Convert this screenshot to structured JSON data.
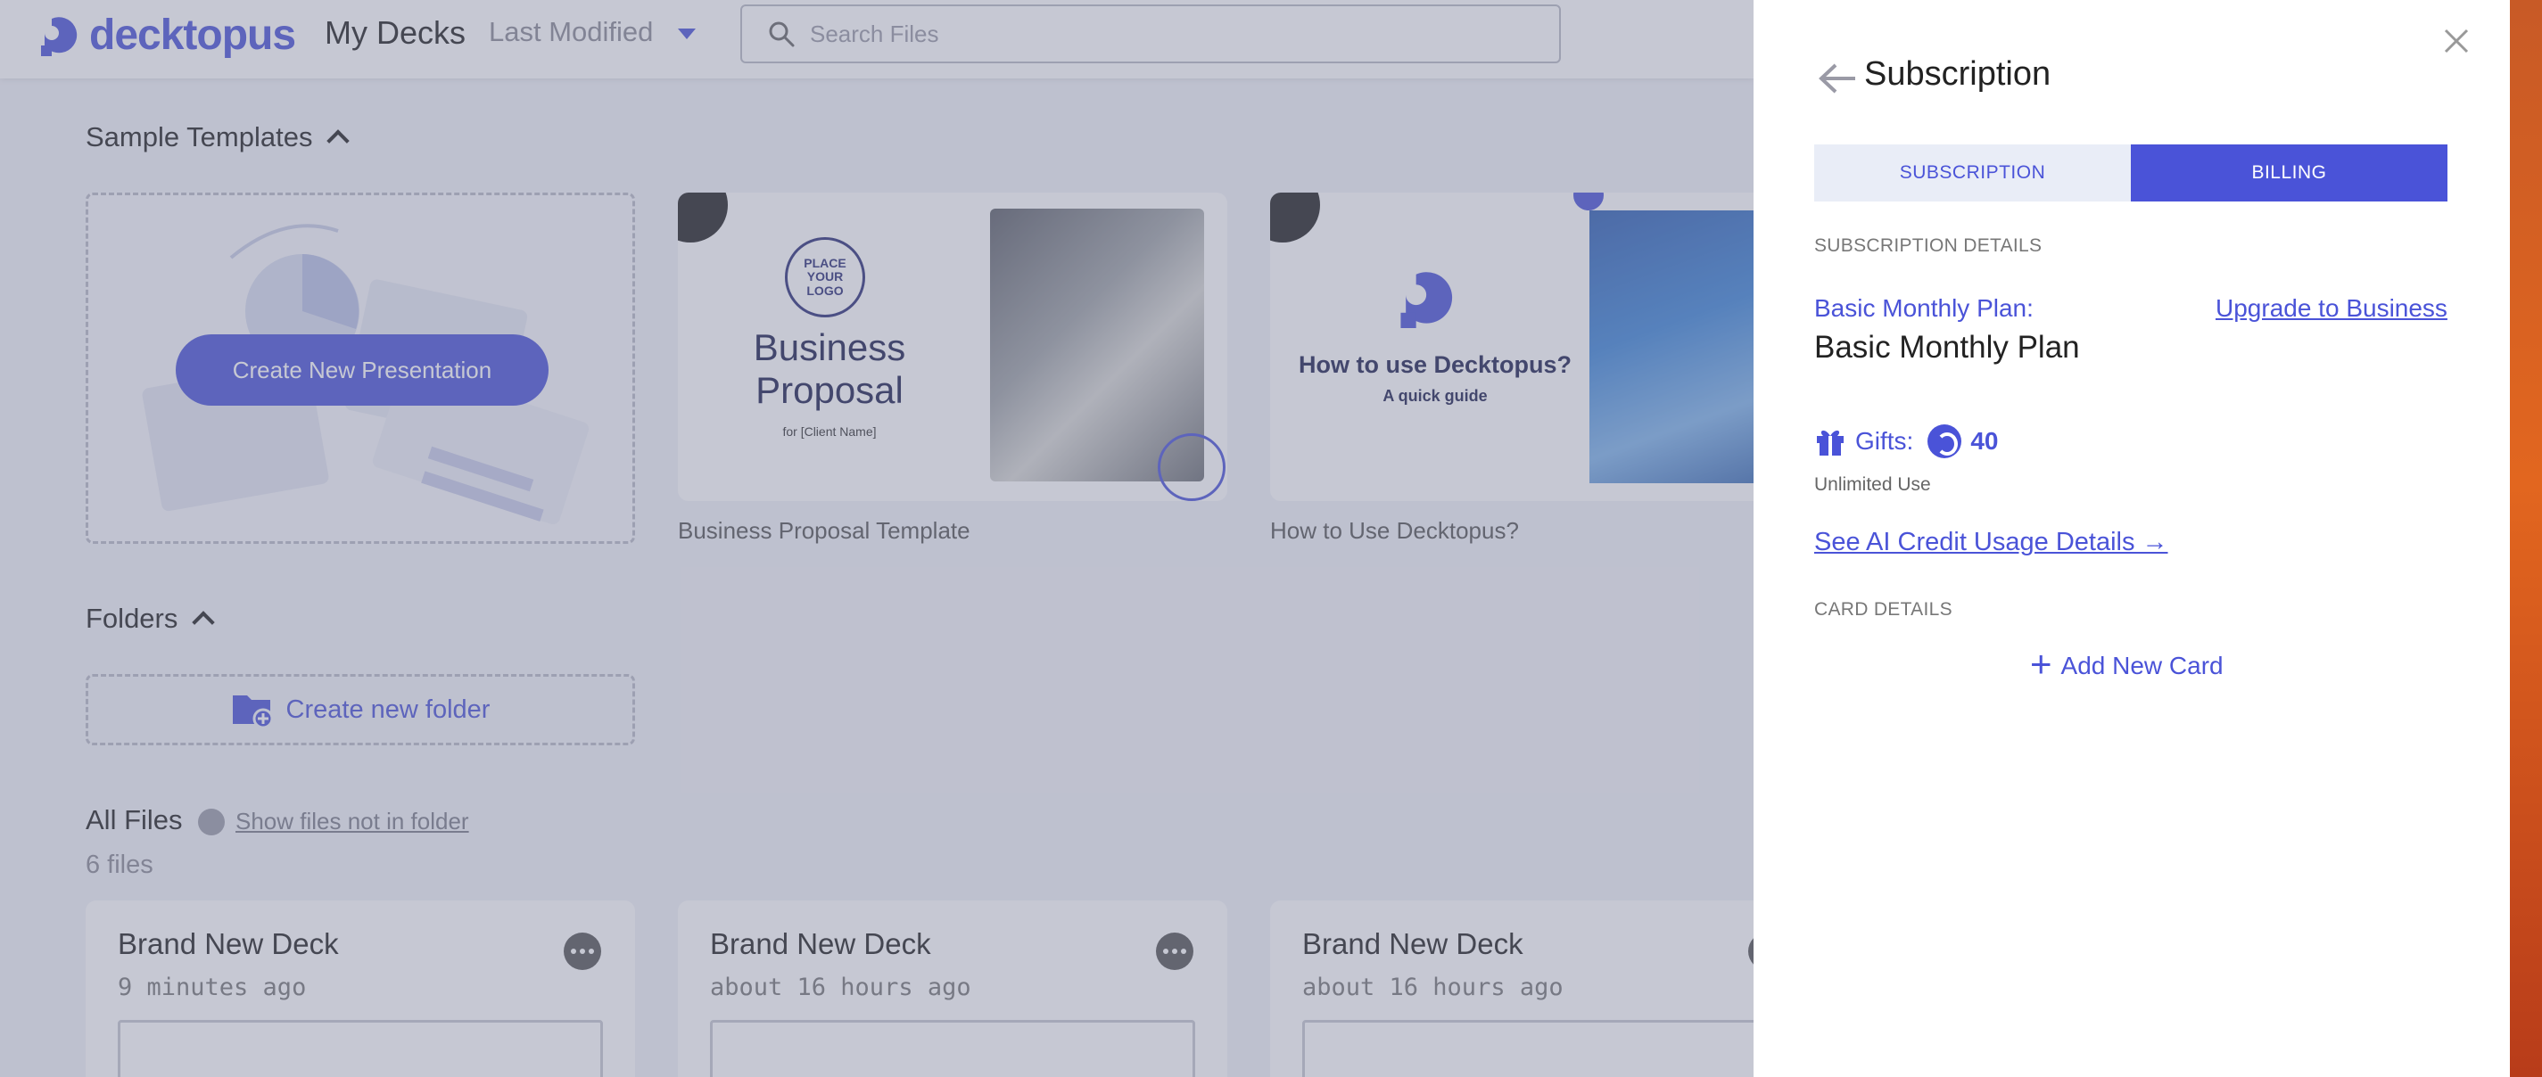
{
  "app": {
    "logo_text": "decktopus",
    "nav_title": "My Decks",
    "sort_label": "Last Modified",
    "search": {
      "placeholder": "Search Files",
      "value": ""
    }
  },
  "templates": {
    "section_title": "Sample Templates",
    "create_button": "Create New Presentation",
    "cards": [
      {
        "caption": "Business Proposal Template",
        "thumb_logo": "PLACE YOUR LOGO",
        "thumb_title": "Business Proposal",
        "thumb_sub": "for [Client Name]"
      },
      {
        "caption": "How to Use Decktopus?",
        "thumb_title": "How to use Decktopus?",
        "thumb_sub": "A quick guide"
      }
    ]
  },
  "folders": {
    "section_title": "Folders",
    "create_label": "Create new folder"
  },
  "files": {
    "title": "All Files",
    "toggle_label": "Show files not in folder",
    "count": "6 files",
    "decks": [
      {
        "name": "Brand New Deck",
        "time": "9 minutes ago"
      },
      {
        "name": "Brand New Deck",
        "time": "about 16 hours ago"
      },
      {
        "name": "Brand New Deck",
        "time": "about 16 hours ago"
      }
    ]
  },
  "panel": {
    "title": "Subscription",
    "tabs": [
      {
        "label": "SUBSCRIPTION",
        "active": false
      },
      {
        "label": "BILLING",
        "active": true
      }
    ],
    "subscription_details_label": "SUBSCRIPTION DETAILS",
    "plan_key": "Basic Monthly Plan:",
    "plan_value": "Basic Monthly Plan",
    "upgrade_link": "Upgrade to Business",
    "gifts_label": "Gifts:",
    "gifts_value": "40",
    "unlimited_label": "Unlimited Use",
    "ai_credit_link": "See AI Credit Usage Details →",
    "card_details_label": "CARD DETAILS",
    "add_card_label": "Add New Card"
  },
  "colors": {
    "accent": "#4a53d8",
    "tab_inactive_bg": "#e9edf7",
    "desktop_edge": "#e2661f"
  },
  "icons": [
    "logo-icon",
    "chevron-down-icon",
    "search-icon",
    "chevron-up-icon",
    "folder-add-icon",
    "list-icon",
    "more-icon",
    "close-icon",
    "arrow-left-icon",
    "gift-icon",
    "credit-icon",
    "plus-icon"
  ]
}
